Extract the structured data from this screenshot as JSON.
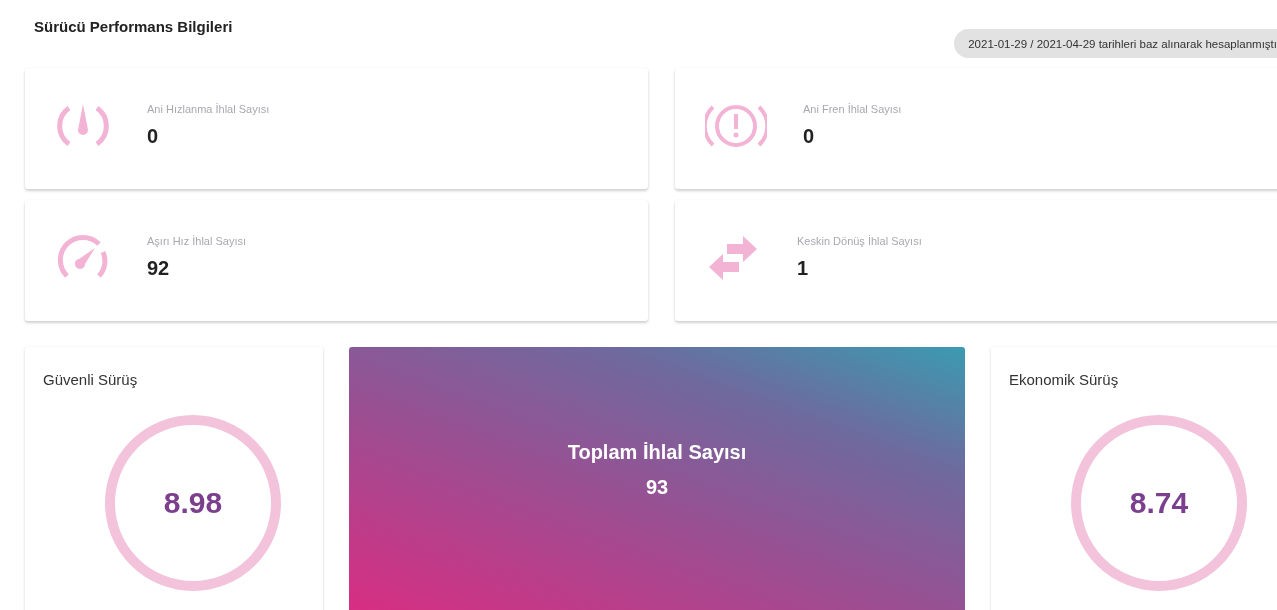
{
  "title": "Sürücü Performans Bilgileri",
  "date_range": "2021-01-29 / 2021-04-29 tarihleri baz alınarak hesaplanmıştı",
  "violations": [
    {
      "kind": "acceleration",
      "label": "Ani Hızlanma İhlal Sayısı",
      "value": "0"
    },
    {
      "kind": "brake",
      "label": "Ani Fren İhlal Sayısı",
      "value": "0"
    },
    {
      "kind": "speed",
      "label": "Aşırı Hız İhlal Sayısı",
      "value": "92"
    },
    {
      "kind": "turn",
      "label": "Keskin Dönüş İhlal Sayısı",
      "value": "1"
    }
  ],
  "scores": [
    {
      "label": "Güvenli Sürüş",
      "value": "8.98"
    },
    {
      "label": "Ekonomik Sürüş",
      "value": "8.74"
    }
  ],
  "total": {
    "label": "Toplam İhlal Sayısı",
    "value": "93"
  }
}
